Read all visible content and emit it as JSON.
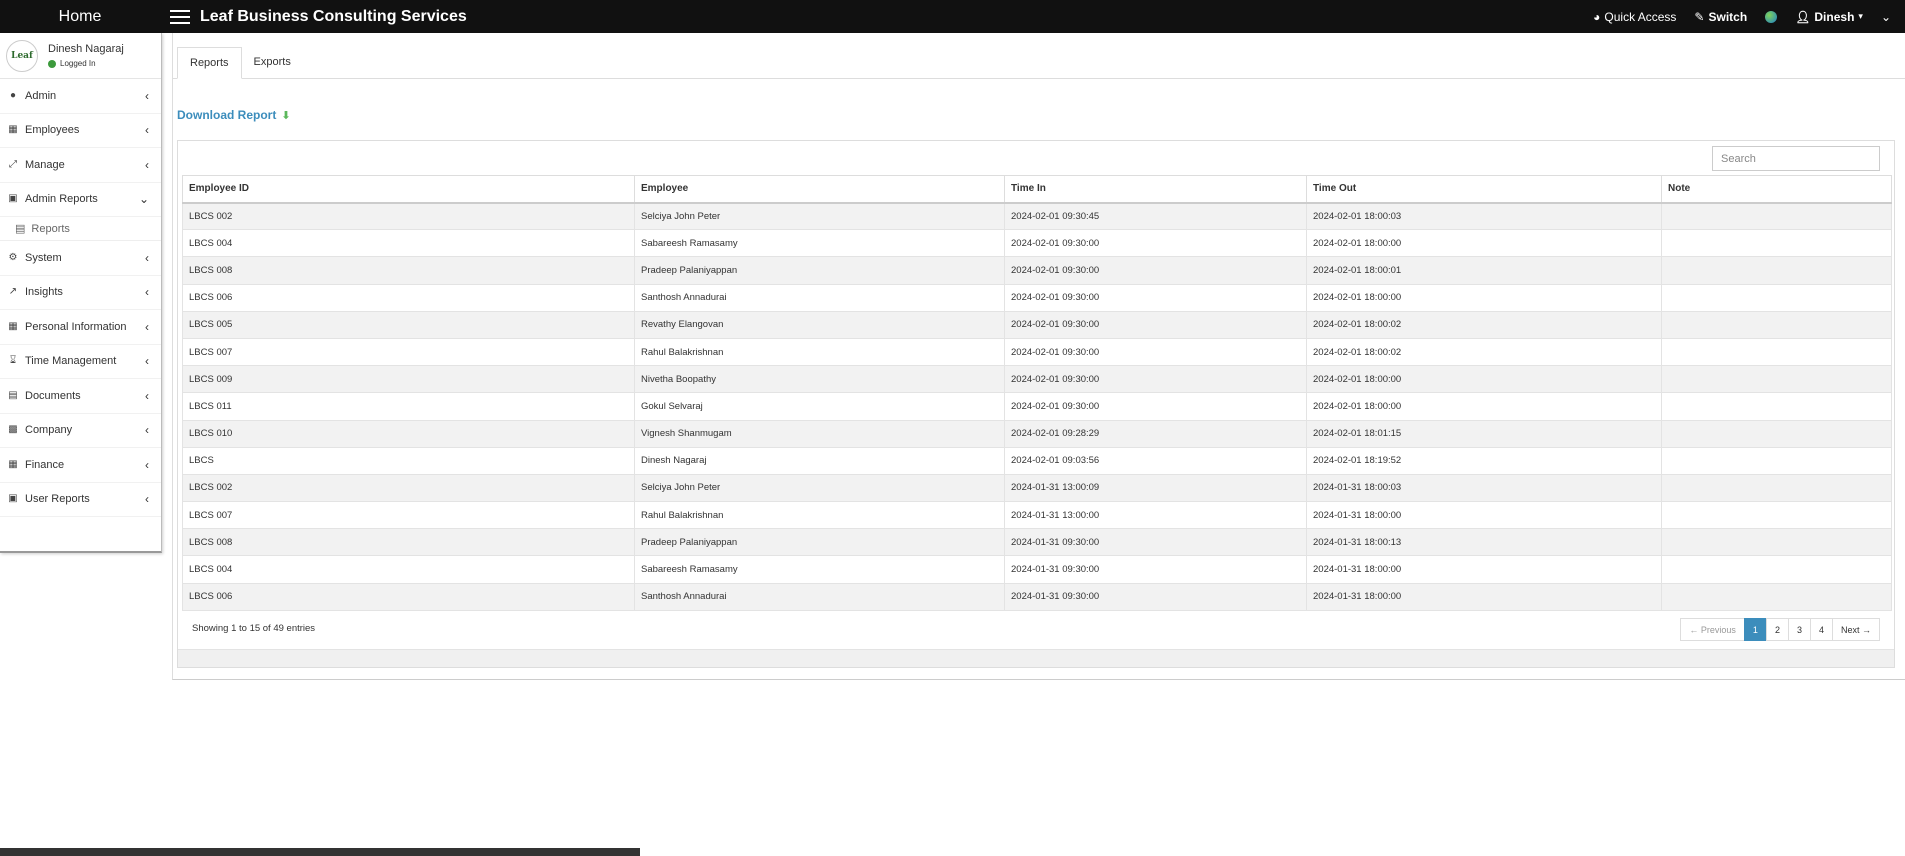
{
  "topbar": {
    "home": "Home",
    "brand": "Leaf Business Consulting Services",
    "quick_access": "Quick Access",
    "switch": "Switch",
    "user": "Dinesh"
  },
  "profile": {
    "logo_text": "Leaf",
    "name": "Dinesh Nagaraj",
    "status": "Logged In"
  },
  "sidebar": {
    "items": [
      {
        "label": "Admin",
        "icon": "users-icon"
      },
      {
        "label": "Employees",
        "icon": "grid-icon"
      },
      {
        "label": "Manage",
        "icon": "manage-icon"
      },
      {
        "label": "Admin Reports",
        "icon": "briefcase-icon"
      },
      {
        "label": "System",
        "icon": "gears-icon"
      },
      {
        "label": "Insights",
        "icon": "chart-icon"
      },
      {
        "label": "Personal Information",
        "icon": "grid-icon"
      },
      {
        "label": "Time Management",
        "icon": "hourglass-icon"
      },
      {
        "label": "Documents",
        "icon": "file-icon"
      },
      {
        "label": "Company",
        "icon": "building-icon"
      },
      {
        "label": "Finance",
        "icon": "calculator-icon"
      },
      {
        "label": "User Reports",
        "icon": "briefcase-icon"
      }
    ],
    "submenu_label": "Reports"
  },
  "tabs": [
    "Reports",
    "Exports"
  ],
  "download_label": "Download Report",
  "search": {
    "placeholder": "Search"
  },
  "table": {
    "headers": [
      "Employee ID",
      "Employee",
      "Time In",
      "Time Out",
      "Note"
    ],
    "rows": [
      [
        "LBCS 002",
        "Selciya John Peter",
        "2024-02-01 09:30:45",
        "2024-02-01 18:00:03",
        ""
      ],
      [
        "LBCS 004",
        "Sabareesh Ramasamy",
        "2024-02-01 09:30:00",
        "2024-02-01 18:00:00",
        ""
      ],
      [
        "LBCS 008",
        "Pradeep Palaniyappan",
        "2024-02-01 09:30:00",
        "2024-02-01 18:00:01",
        ""
      ],
      [
        "LBCS 006",
        "Santhosh Annadurai",
        "2024-02-01 09:30:00",
        "2024-02-01 18:00:00",
        ""
      ],
      [
        "LBCS 005",
        "Revathy Elangovan",
        "2024-02-01 09:30:00",
        "2024-02-01 18:00:02",
        ""
      ],
      [
        "LBCS 007",
        "Rahul Balakrishnan",
        "2024-02-01 09:30:00",
        "2024-02-01 18:00:02",
        ""
      ],
      [
        "LBCS 009",
        "Nivetha Boopathy",
        "2024-02-01 09:30:00",
        "2024-02-01 18:00:00",
        ""
      ],
      [
        "LBCS 011",
        "Gokul Selvaraj",
        "2024-02-01 09:30:00",
        "2024-02-01 18:00:00",
        ""
      ],
      [
        "LBCS 010",
        "Vignesh Shanmugam",
        "2024-02-01 09:28:29",
        "2024-02-01 18:01:15",
        ""
      ],
      [
        "LBCS",
        "Dinesh Nagaraj",
        "2024-02-01 09:03:56",
        "2024-02-01 18:19:52",
        ""
      ],
      [
        "LBCS 002",
        "Selciya John Peter",
        "2024-01-31 13:00:09",
        "2024-01-31 18:00:03",
        ""
      ],
      [
        "LBCS 007",
        "Rahul Balakrishnan",
        "2024-01-31 13:00:00",
        "2024-01-31 18:00:00",
        ""
      ],
      [
        "LBCS 008",
        "Pradeep Palaniyappan",
        "2024-01-31 09:30:00",
        "2024-01-31 18:00:13",
        ""
      ],
      [
        "LBCS 004",
        "Sabareesh Ramasamy",
        "2024-01-31 09:30:00",
        "2024-01-31 18:00:00",
        ""
      ],
      [
        "LBCS 006",
        "Santhosh Annadurai",
        "2024-01-31 09:30:00",
        "2024-01-31 18:00:00",
        ""
      ]
    ]
  },
  "footer": {
    "info": "Showing 1 to 15 of 49 entries",
    "pager": {
      "previous": "← Previous",
      "pages": [
        "1",
        "2",
        "3",
        "4"
      ],
      "next": "Next →"
    }
  },
  "colors": {
    "accent": "#3c8dbc",
    "topbar": "#111111",
    "online": "#3c9a3c"
  }
}
